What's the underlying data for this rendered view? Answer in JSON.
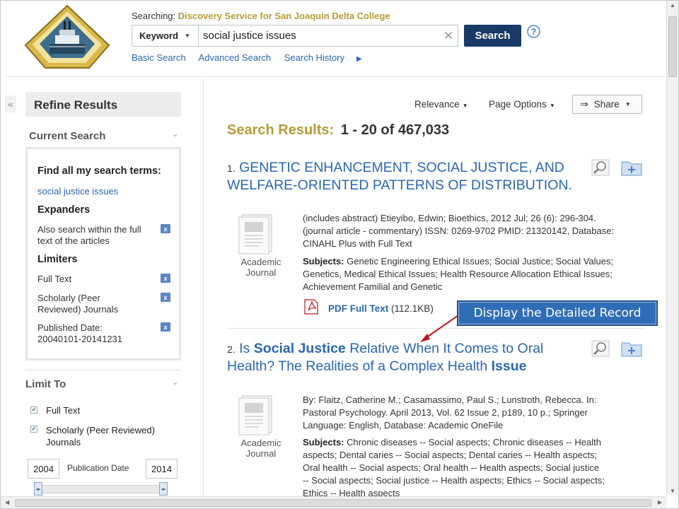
{
  "header": {
    "searching_prefix": "Searching:",
    "service_name": "Discovery Service for San Joaquin Delta College",
    "field_select": "Keyword",
    "query": "social justice issues",
    "search_button": "Search",
    "help": "?",
    "links": [
      "Basic Search",
      "Advanced Search",
      "Search History"
    ]
  },
  "sidebar": {
    "collapse": "«",
    "refine_title": "Refine Results",
    "current_search_title": "Current Search",
    "find_all_title": "Find all my search terms:",
    "find_all_value": "social justice issues",
    "expanders_title": "Expanders",
    "expanders": [
      {
        "line1": "Also search within the full",
        "line2": "text of the articles"
      }
    ],
    "limiters_title": "Limiters",
    "limiters": [
      {
        "line1": "Full Text",
        "line2": ""
      },
      {
        "line1": "Scholarly (Peer",
        "line2": "Reviewed) Journals"
      },
      {
        "line1": "Published Date:",
        "line2": "20040101-20141231"
      }
    ],
    "remove_label": "x",
    "limit_to_title": "Limit To",
    "limit_options": [
      {
        "line1": "Full Text",
        "line2": "",
        "checked": true
      },
      {
        "line1": "Scholarly (Peer Reviewed)",
        "line2": "Journals",
        "checked": true
      }
    ],
    "pub_date_from": "2004",
    "pub_date_label": "Publication Date",
    "pub_date_to": "2014"
  },
  "toolbar": {
    "relevance": "Relevance",
    "page_options": "Page Options",
    "share": "Share"
  },
  "results": {
    "heading_label": "Search Results:",
    "heading_range": "1 - 20 of 467,033",
    "items": [
      {
        "number": "1.",
        "title": "GENETIC ENHANCEMENT, SOCIAL JUSTICE, AND WELFARE-ORIENTED PATTERNS OF DISTRIBUTION.",
        "type_line1": "Academic",
        "type_line2": "Journal",
        "meta_lines": [
          "(includes abstract) Etieyibo, Edwin; Bioethics, 2012 Jul; 26 (6): 296-304.",
          "(journal article - commentary) ISSN: 0269-9702 PMID: 21320142, Database:",
          "CINAHL Plus with Full Text"
        ],
        "subjects_label": "Subjects:",
        "subjects_lines": [
          "Genetic Engineering Ethical Issues; Social Justice; Social Values;",
          "Genetics, Medical Ethical Issues; Health Resource Allocation Ethical Issues;",
          "Achievement Familial and Genetic"
        ],
        "pdf_label": "PDF Full Text",
        "pdf_size": "(112.1KB)"
      },
      {
        "number": "2.",
        "title_parts": [
          "Is ",
          "Social Justice",
          " Relative When It Comes to Oral Health? The Realities of a Complex Health ",
          "Issue"
        ],
        "type_line1": "Academic",
        "type_line2": "Journal",
        "meta_lines": [
          "By: Flaitz, Catherine M.; Casamassimo, Paul S.; Lunstroth, Rebecca. In:",
          "Pastoral Psychology. April 2013, Vol. 62 Issue 2, p189, 10 p.; Springer",
          "Language: English, Database: Academic OneFile"
        ],
        "subjects_label": "Subjects:",
        "subjects_lines": [
          "Chronic diseases -- Social aspects; Chronic diseases -- Health",
          "aspects; Dental caries -- Social aspects; Dental caries -- Health aspects;",
          "Oral health -- Social aspects; Oral health -- Health aspects; Social justice",
          "-- Social aspects; Social justice -- Health aspects; Ethics -- Social aspects;",
          "Ethics -- Health aspects"
        ]
      }
    ]
  },
  "callout": "Display the Detailed Record",
  "colors": {
    "accent_gold": "#b89a38",
    "link_blue": "#2a66b3",
    "button_navy": "#173a66",
    "callout_blue": "#2f6db6"
  }
}
